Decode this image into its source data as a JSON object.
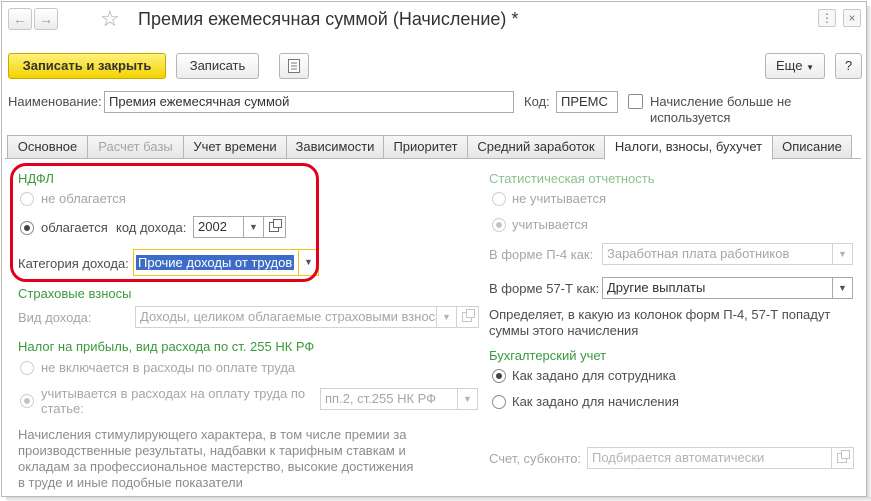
{
  "window": {
    "title": "Премия ежемесячная суммой (Начисление) *",
    "nav_back_icon": "arrow-left-icon",
    "nav_forward_icon": "arrow-right-icon",
    "favorite_icon": "star-icon"
  },
  "toolbar": {
    "save_close_label": "Записать и закрыть",
    "save_label": "Записать",
    "more_label": "Еще",
    "help_label": "?"
  },
  "header": {
    "name_label": "Наименование:",
    "name_value": "Премия ежемесячная суммой",
    "code_label": "Код:",
    "code_value": "ПРЕМС",
    "not_used_label_line1": "Начисление больше не",
    "not_used_label_line2": "используется"
  },
  "tabs": [
    {
      "label": "Основное"
    },
    {
      "label": "Расчет базы"
    },
    {
      "label": "Учет времени"
    },
    {
      "label": "Зависимости"
    },
    {
      "label": "Приоритет"
    },
    {
      "label": "Средний заработок"
    },
    {
      "label": "Налоги, взносы, бухучет"
    },
    {
      "label": "Описание"
    }
  ],
  "ndfl": {
    "title": "НДФЛ",
    "not_taxed_label": "не облагается",
    "taxed_label": "облагается",
    "income_code_label": "код дохода:",
    "income_code_value": "2002",
    "income_category_label": "Категория дохода:",
    "income_category_value": "Прочие доходы от трудов"
  },
  "insurance": {
    "title": "Страховые взносы",
    "income_type_label": "Вид дохода:",
    "income_type_value": "Доходы, целиком облагаемые страховыми взносами"
  },
  "profit_tax": {
    "title": "Налог на прибыль, вид расхода по ст. 255 НК РФ",
    "not_included_label": "не включается в расходы по оплате труда",
    "included_label_line1": "учитывается в расходах на оплату труда по",
    "included_label_line2": "статье:",
    "article_value": "пп.2, ст.255 НК РФ",
    "description": [
      "Начисления стимулирующего характера, в том числе премии за",
      "производственные результаты, надбавки к тарифным ставкам и",
      "окладам за профессиональное мастерство, высокие достижения",
      "в труде и иные подобные показатели"
    ]
  },
  "statistics": {
    "title": "Статистическая отчетность",
    "not_counted_label": "не учитывается",
    "counted_label": "учитывается",
    "p4_label": "В форме П-4 как:",
    "p4_value": "Заработная плата работников",
    "f57_label": "В форме 57-Т как:",
    "f57_value": "Другие выплаты",
    "hint_line1": "Определяет, в какую из колонок форм П-4, 57-Т попадут",
    "hint_line2": "суммы этого начисления"
  },
  "accounting": {
    "title": "Бухгалтерский учет",
    "per_employee_label": "Как задано для сотрудника",
    "per_accrual_label": "Как задано для начисления",
    "account_label": "Счет, субконто:",
    "account_placeholder": "Подбирается автоматически"
  },
  "colors": {
    "primary_button": "#f3d200",
    "section_title": "#3a9a3a",
    "selection": "#3d6cc4",
    "annotation_frame": "#e3001b"
  }
}
